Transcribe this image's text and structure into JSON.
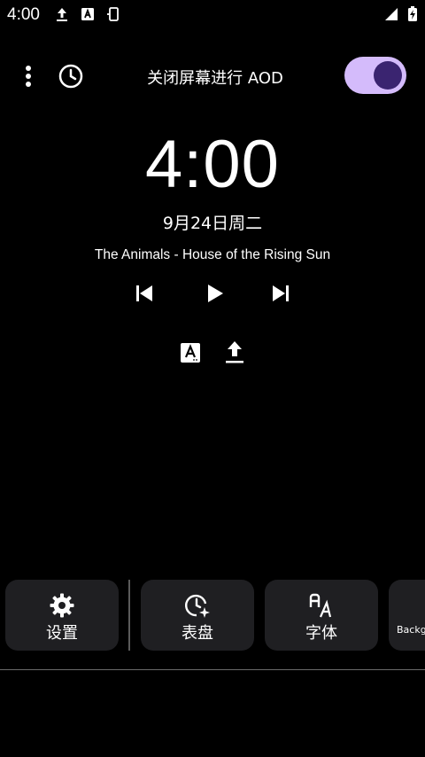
{
  "status_bar": {
    "time": "4:00",
    "icons": [
      "upload-icon",
      "font-a-icon",
      "phone-rotate-icon",
      "signal-icon",
      "battery-charging-icon"
    ]
  },
  "top_bar": {
    "menu_icon": "more-vert-icon",
    "history_icon": "clock-icon",
    "aod_label": "关闭屏幕进行 AOD",
    "aod_toggle_on": true
  },
  "clock": {
    "time": "4:00",
    "date": "9月24日周二"
  },
  "media": {
    "track": "The Animals - House of the Rising Sun",
    "controls": [
      "skip-previous-icon",
      "play-icon",
      "skip-next-icon"
    ]
  },
  "notification_icons": [
    "font-a-icon",
    "upload-icon"
  ],
  "cards": [
    {
      "label": "设置",
      "icon": "gear-icon"
    },
    {
      "label": "表盘",
      "icon": "clock-sparkle-icon"
    },
    {
      "label": "字体",
      "icon": "font-size-icon"
    },
    {
      "label": "Backgr",
      "icon": ""
    }
  ],
  "colors": {
    "background": "#000000",
    "card": "#1f1f22",
    "toggle_track": "#d4bbfb",
    "toggle_knob": "#3a2470"
  }
}
